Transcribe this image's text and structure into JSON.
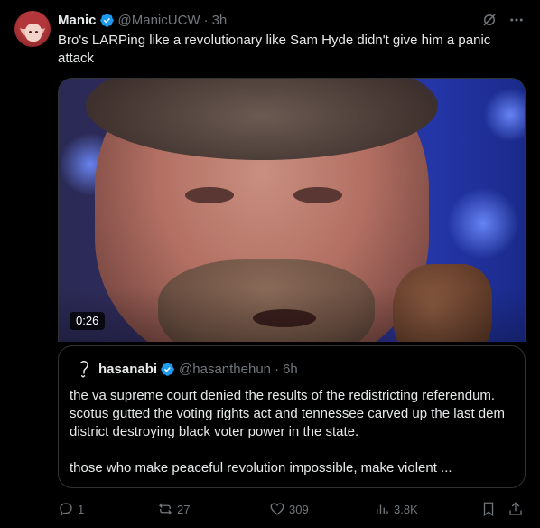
{
  "tweet": {
    "author_name": "Manic",
    "author_handle": "@ManicUCW",
    "separator": "·",
    "time": "3h",
    "text": "Bro's LARPing like a revolutionary like Sam Hyde didn't give him a panic attack",
    "media": {
      "duration": "0:26"
    }
  },
  "quote": {
    "author_name": "hasanabi",
    "author_handle": "@hasanthehun",
    "separator": "·",
    "time": "6h",
    "paragraphs": [
      "the va supreme court denied the results of the redistricting referendum. scotus gutted the voting rights act and tennessee carved up the last dem district destroying black voter power in the state.",
      "those who make peaceful revolution impossible, make violent ..."
    ]
  },
  "actions": {
    "replies": "1",
    "reposts": "27",
    "likes": "309",
    "views": "3.8K"
  },
  "icons": [
    "grok-icon",
    "more-icon",
    "verified-badge-icon",
    "reply-icon",
    "repost-icon",
    "like-icon",
    "views-icon",
    "bookmark-icon",
    "share-icon"
  ],
  "colors": {
    "background": "#000000",
    "text": "#e7e9ea",
    "secondary": "#71767b",
    "verified": "#1d9bf0",
    "border": "#2f3336"
  }
}
